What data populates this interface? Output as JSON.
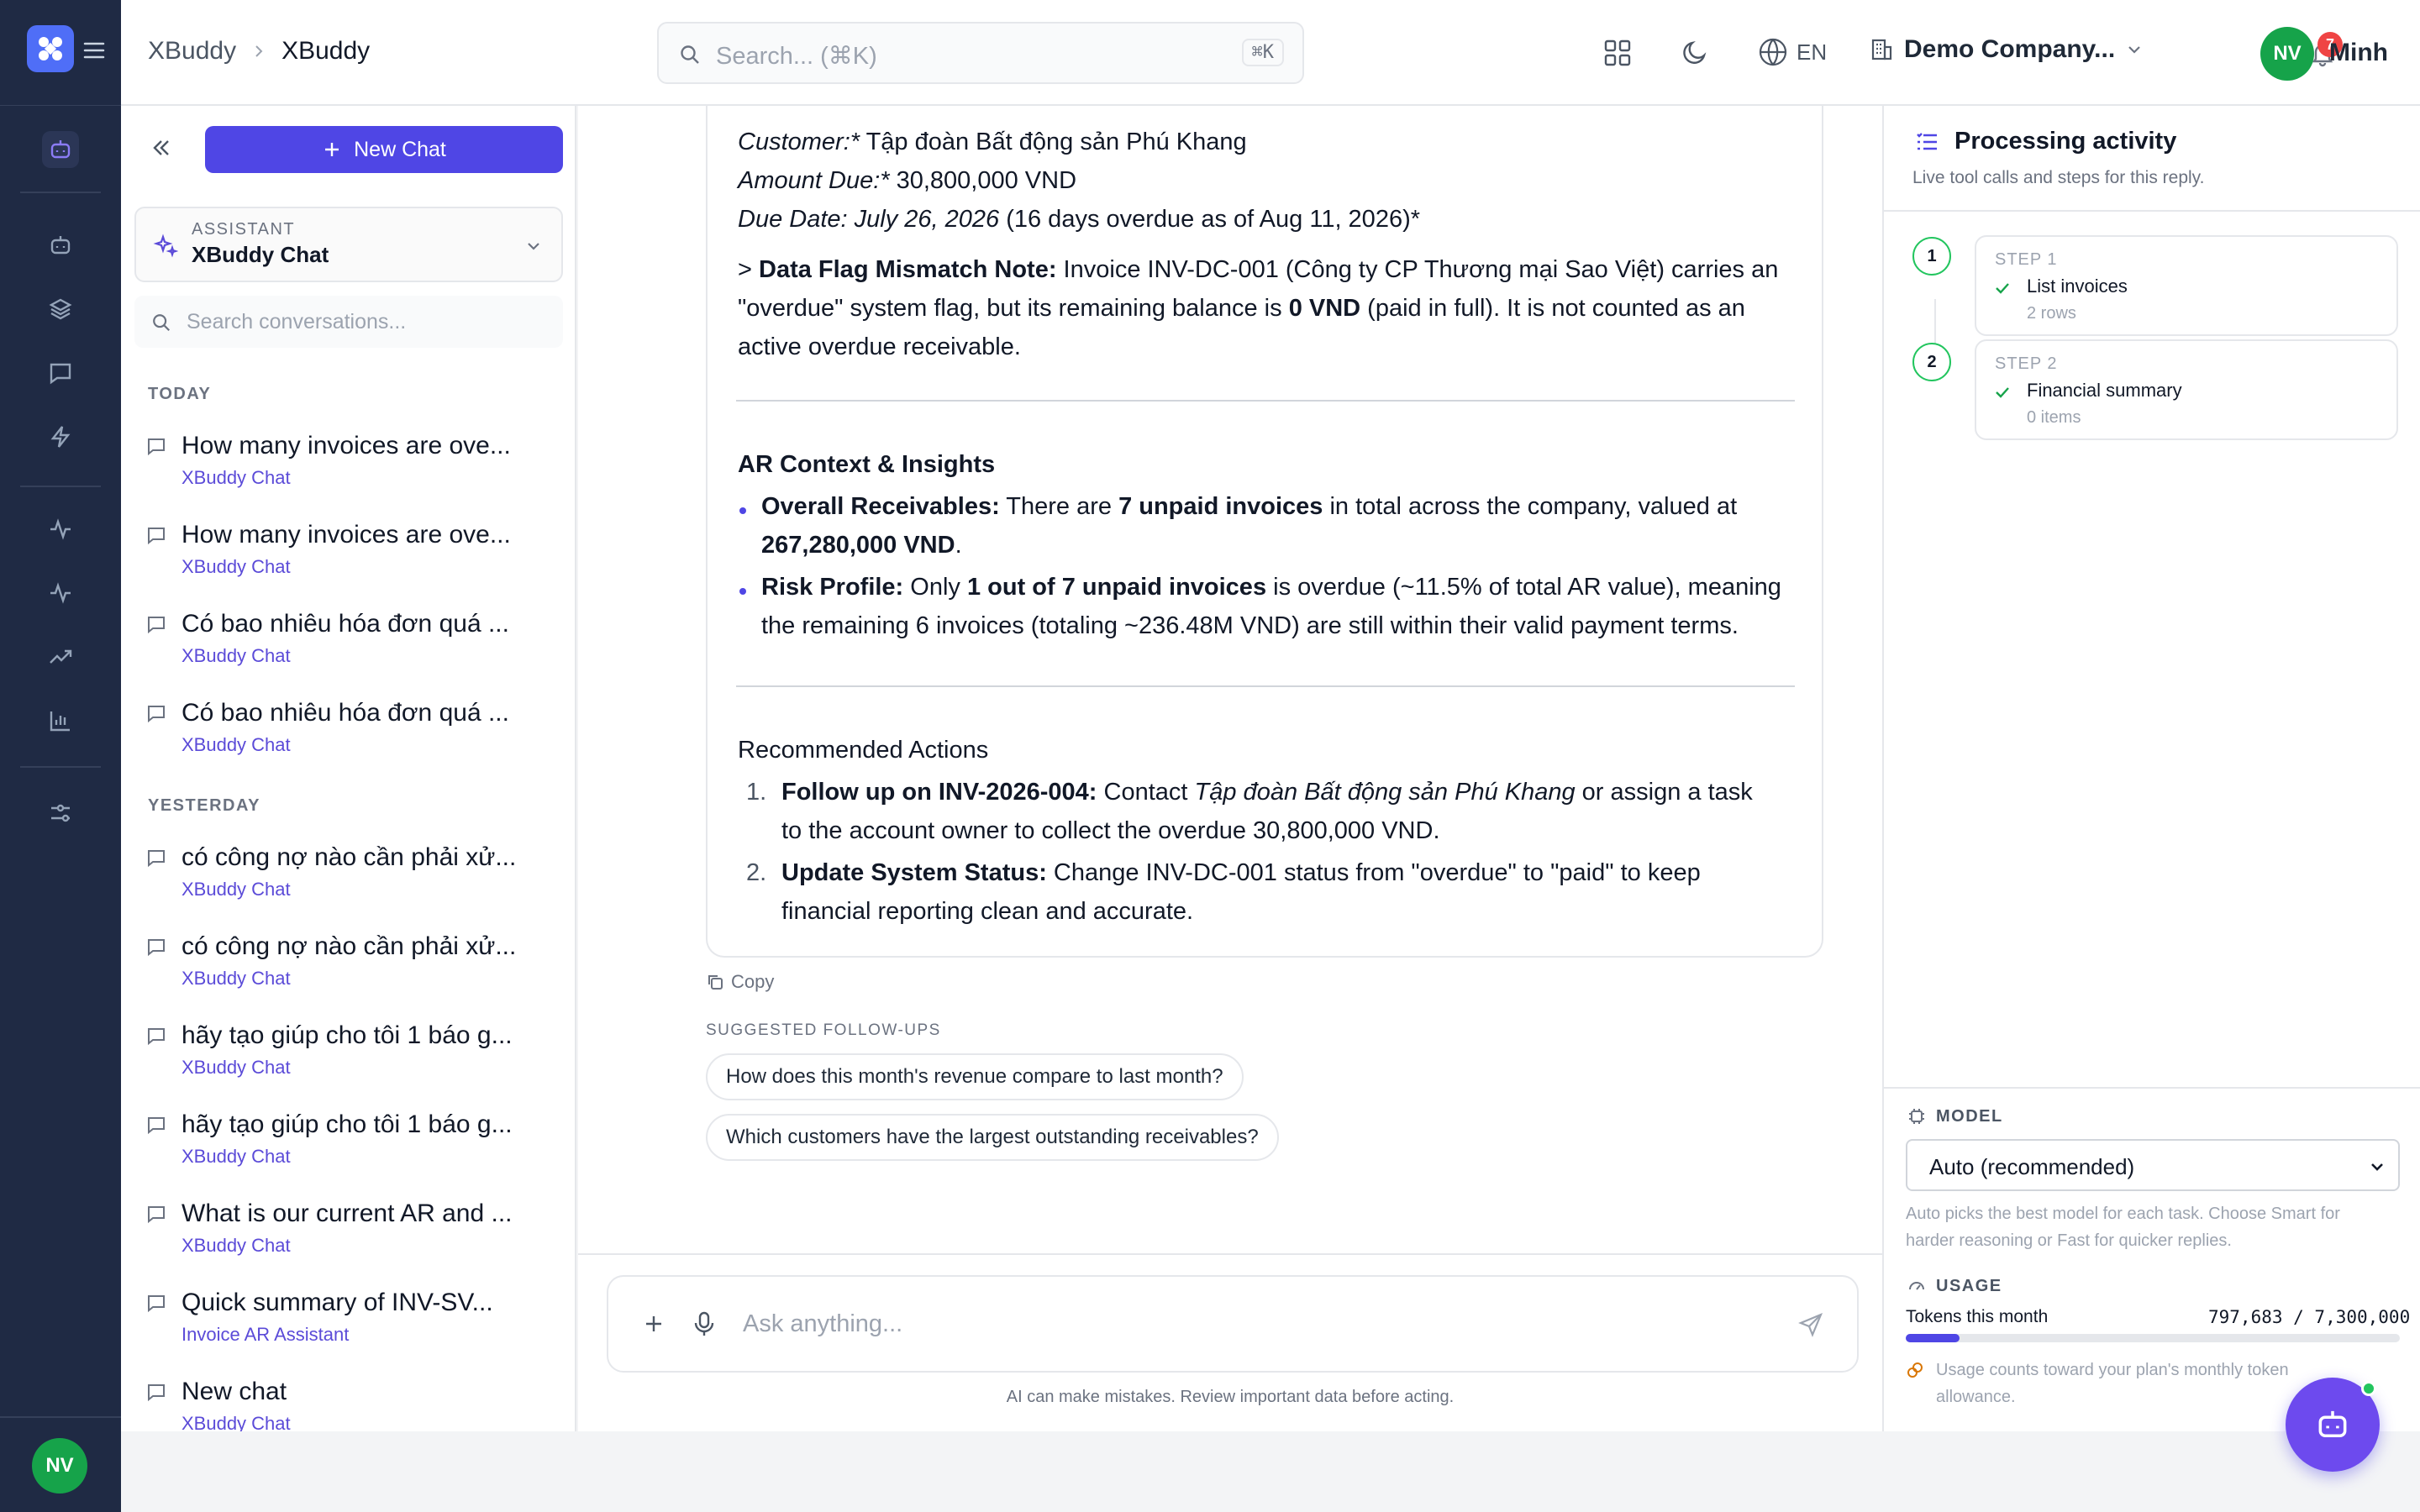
{
  "topbar": {
    "breadcrumb_root": "XBuddy",
    "breadcrumb_current": "XBuddy",
    "search_placeholder": "Search... (⌘K)",
    "search_shortcut": "⌘K",
    "language": "EN",
    "company": "Demo Company...",
    "notification_count": "7",
    "user_initials": "NV",
    "user_name": "Minh"
  },
  "sidebar": {
    "new_chat": "New Chat",
    "assistant_label": "ASSISTANT",
    "assistant_name": "XBuddy Chat",
    "search_placeholder": "Search conversations...",
    "today_label": "TODAY",
    "yesterday_label": "YESTERDAY",
    "conversations": [
      {
        "title": "How many invoices are ove...",
        "subtitle": "XBuddy Chat"
      },
      {
        "title": "How many invoices are ove...",
        "subtitle": "XBuddy Chat"
      },
      {
        "title": "Có bao nhiêu hóa đơn quá ...",
        "subtitle": "XBuddy Chat"
      },
      {
        "title": "Có bao nhiêu hóa đơn quá ...",
        "subtitle": "XBuddy Chat"
      },
      {
        "title": "có công nợ nào cần phải xử...",
        "subtitle": "XBuddy Chat"
      },
      {
        "title": "có công nợ nào cần phải xử...",
        "subtitle": "XBuddy Chat"
      },
      {
        "title": "hãy tạo giúp cho tôi 1 báo g...",
        "subtitle": "XBuddy Chat"
      },
      {
        "title": "hãy tạo giúp cho tôi 1 báo g...",
        "subtitle": "XBuddy Chat"
      },
      {
        "title": "What is our current AR and ...",
        "subtitle": "XBuddy Chat"
      },
      {
        "title": "Quick summary of INV-SV...",
        "subtitle": "Invoice AR Assistant"
      },
      {
        "title": "New chat",
        "subtitle": "XBuddy Chat"
      }
    ],
    "user_initials": "NV"
  },
  "message": {
    "customer_label": "Customer:*",
    "customer_value": " Tập đoàn Bất động sản Phú Khang",
    "amount_label": "Amount Due:*",
    "amount_value": " 30,800,000 VND",
    "due_label": "Due Date: July 26, 2026",
    "due_value": " (16 days overdue as of Aug 11, 2026)*",
    "flag_prefix": "> ",
    "flag_label": "Data Flag Mismatch Note:",
    "flag_text1": " Invoice INV-DC-001 (Công ty CP Thương mại Sao Việt) carries an",
    "flag_text2a": "\"overdue\" system flag, but its remaining balance is ",
    "flag_bold": "0 VND",
    "flag_text2b": " (paid in full). It is not counted as an",
    "flag_text3": "active overdue receivable.",
    "context_heading": "AR Context & Insights",
    "b1_label": "Overall Receivables:",
    "b1_text": " There are ",
    "b1_bold": "7 unpaid invoices",
    "b1_text2": " in total across the company, valued at",
    "b1_bold2": "267,280,000 VND",
    "b1_end": ".",
    "b2_label": "Risk Profile:",
    "b2_text": " Only ",
    "b2_bold": "1 out of 7 unpaid invoices",
    "b2_text2": " is overdue (~11.5% of total AR value), meaning",
    "b2_line2": "the remaining 6 invoices (totaling ~236.48M VND) are still within their valid payment terms.",
    "actions_heading": "Recommended Actions",
    "a1_num": "1.",
    "a1_label": "Follow up on INV-2026-004:",
    "a1_text": " Contact ",
    "a1_italic": "Tập đoàn Bất động sản Phú Khang",
    "a1_text2": " or assign a task",
    "a1_line2": "to the account owner to collect the overdue 30,800,000 VND.",
    "a2_num": "2.",
    "a2_label": "Update System Status:",
    "a2_text": " Change INV-DC-001 status from \"overdue\" to \"paid\" to keep",
    "a2_line2": "financial reporting clean and accurate."
  },
  "copy_label": "Copy",
  "followups": {
    "label": "SUGGESTED FOLLOW-UPS",
    "items": [
      "How does this month's revenue compare to last month?",
      "Which customers have the largest outstanding receivables?"
    ]
  },
  "composer": {
    "placeholder": "Ask anything...",
    "disclaimer": "AI can make mistakes. Review important data before acting."
  },
  "activity": {
    "title": "Processing activity",
    "subtitle": "Live tool calls and steps for this reply.",
    "steps": [
      {
        "num": "1",
        "label": "STEP 1",
        "name": "List invoices",
        "detail": "2 rows"
      },
      {
        "num": "2",
        "label": "STEP 2",
        "name": "Financial summary",
        "detail": "0 items"
      }
    ]
  },
  "model": {
    "label": "MODEL",
    "selected": "Auto (recommended)",
    "help1": "Auto picks the best model for each task. Choose Smart for",
    "help2": "harder reasoning or Fast for quicker replies."
  },
  "usage": {
    "label": "USAGE",
    "tokens_label": "Tokens this month",
    "tokens_value": "797,683 / 7,300,000",
    "tokens_fraction": 0.109,
    "note1": "Usage counts toward your plan's monthly token",
    "note2": "allowance."
  },
  "colors": {
    "accent": "#4f46e5",
    "rail": "#1f2a44",
    "success": "#22c55e",
    "danger": "#ef4444"
  }
}
